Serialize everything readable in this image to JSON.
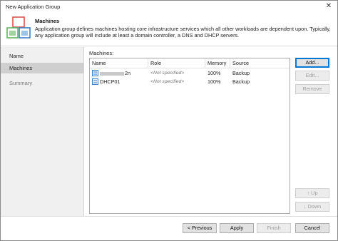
{
  "window": {
    "title": "New Application Group",
    "close_glyph": "✕"
  },
  "header": {
    "title": "Machines",
    "description": "Application group defines machines hosting core infrastructure services which all other workloads are dependent upon. Typically, any application group will include at least a domain controller, a DNS and DHCP servers."
  },
  "sidebar": {
    "items": [
      {
        "label": "Name",
        "state": "normal"
      },
      {
        "label": "Machines",
        "state": "active"
      },
      {
        "label": "Summary",
        "state": "dim"
      }
    ]
  },
  "machines": {
    "label": "Machines:",
    "columns": [
      "Name",
      "Role",
      "Memory",
      "Source"
    ],
    "rows": [
      {
        "name": "2n",
        "name_obscured": true,
        "role": "<Not specified>",
        "memory": "100%",
        "source": "Backup"
      },
      {
        "name": "DHCP01",
        "name_obscured": false,
        "role": "<Not specified>",
        "memory": "100%",
        "source": "Backup"
      }
    ]
  },
  "side_buttons": {
    "add": "Add...",
    "edit": "Edit...",
    "remove": "Remove",
    "up": "Up",
    "down": "Down"
  },
  "footer": {
    "previous": "< Previous",
    "apply": "Apply",
    "finish": "Finish",
    "cancel": "Cancel"
  },
  "icons": {
    "logo": "application-group-icon",
    "server": "server-icon",
    "up": "arrow-up-icon",
    "down": "arrow-down-icon"
  },
  "colors": {
    "accent": "#0078d7",
    "logo_red": "#d9534f",
    "logo_green": "#5cb85c",
    "logo_blue": "#3c7fc6"
  }
}
